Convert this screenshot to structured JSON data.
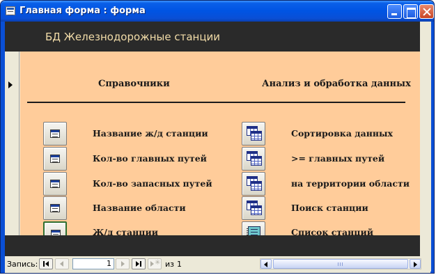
{
  "window": {
    "title": "Главная форма : форма"
  },
  "form": {
    "header_title": "БД Железнодорожные станции",
    "col_left_title": "Справочники",
    "col_right_title": "Анализ и обработка данных",
    "left_items": [
      {
        "label": "Название ж/д станции",
        "icon": "form-icon"
      },
      {
        "label": "Кол-во главных путей",
        "icon": "form-icon"
      },
      {
        "label": "Кол-во запасных путей",
        "icon": "form-icon"
      },
      {
        "label": "Название области",
        "icon": "form-icon"
      },
      {
        "label": "Ж/д станции",
        "icon": "form-icon"
      }
    ],
    "right_items": [
      {
        "label": "Сортировка данных",
        "icon": "query-icon"
      },
      {
        "label": ">= главных путей",
        "icon": "query-icon"
      },
      {
        "label": "на территории области",
        "icon": "query-icon"
      },
      {
        "label": "Поиск станции",
        "icon": "query-icon"
      },
      {
        "label": "Список станций",
        "icon": "report-icon"
      }
    ],
    "colors": {
      "header": "#2a2a2a",
      "header_text": "#f2dca8",
      "detail": "#ffcc9a"
    }
  },
  "navigator": {
    "record_label": "Запись:",
    "current": "1",
    "of_label": "из",
    "total": "1"
  }
}
